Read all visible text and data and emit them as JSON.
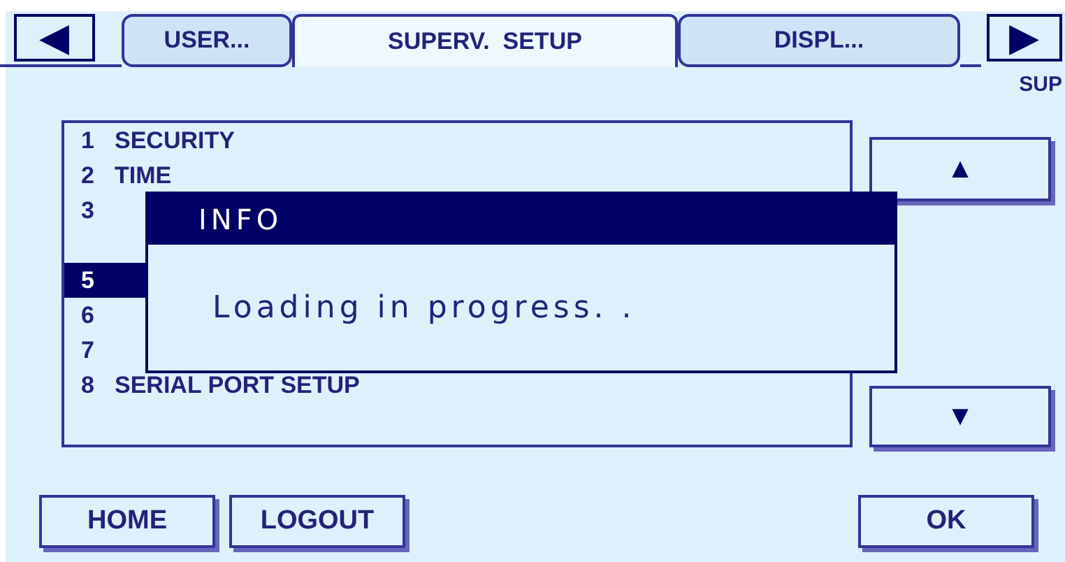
{
  "nav": {
    "prev": "◀",
    "next": "▶",
    "section": "SUP"
  },
  "tabs": [
    {
      "label": "USER...",
      "selected": false
    },
    {
      "label": "SUPERV.  SETUP",
      "selected": true
    },
    {
      "label": "DISPL...",
      "selected": false
    }
  ],
  "menu": {
    "items": [
      {
        "number": "1",
        "label": "SECURITY",
        "selected": false
      },
      {
        "number": "2",
        "label": "TIME",
        "selected": false
      },
      {
        "number": "3",
        "selected": false
      },
      {
        "number": "5",
        "selected": true
      },
      {
        "number": "6",
        "selected": false
      },
      {
        "number": "7",
        "selected": false
      },
      {
        "number": "8",
        "label": "SERIAL PORT SETUP",
        "selected": false
      }
    ],
    "scroll_up": "▲",
    "scroll_down": "▼"
  },
  "dialog": {
    "title": "INFO",
    "message": "Loading in progress. ."
  },
  "buttons": {
    "left": [
      "HOME",
      "LOGOUT"
    ],
    "right": [
      "OK"
    ]
  }
}
